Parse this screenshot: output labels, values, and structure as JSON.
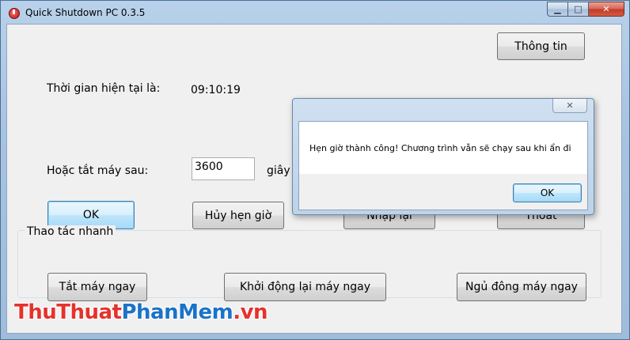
{
  "window": {
    "title": "Quick Shutdown PC 0.3.5",
    "minimize_glyph": "▁",
    "maximize_glyph": "□",
    "close_glyph": "✕"
  },
  "main": {
    "info_button": "Thông tin",
    "current_time_label": "Thời gian hiện tại là:",
    "current_time_value": "09:10:19",
    "shutdown_after_label": "Hoặc tắt máy sau:",
    "shutdown_after_value": "3600",
    "unit_label": "giây",
    "ok_button": "OK",
    "cancel_schedule_button": "Hủy hẹn giờ",
    "hidden_button_1": "Nhập lại",
    "hidden_button_2": "Thoát"
  },
  "quick_actions": {
    "group_title": "Thao tác nhanh",
    "shutdown_now": "Tắt máy ngay",
    "restart_now": "Khởi động lại máy ngay",
    "hibernate_now": "Ngủ đông máy ngay"
  },
  "dialog": {
    "close_glyph": "✕",
    "message": "Hẹn giờ thành công! Chương trình vẫn sẽ chạy sau khi ẩn đi",
    "ok_button": "OK"
  },
  "watermark": {
    "part1": "ThuThuat",
    "part2": "PhanMem",
    "part3": ".vn"
  }
}
